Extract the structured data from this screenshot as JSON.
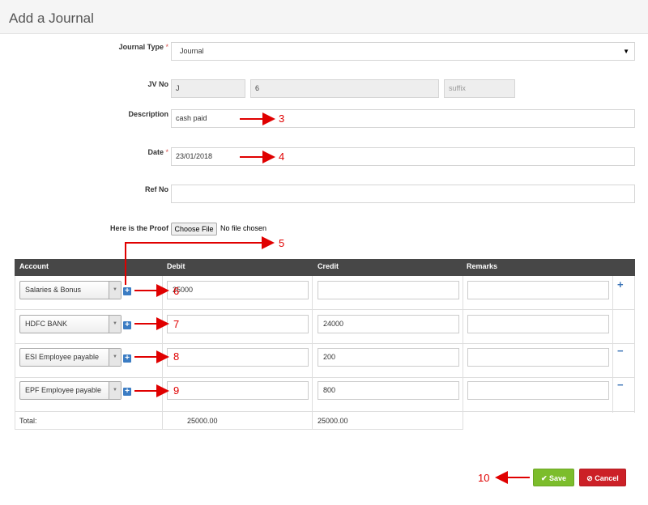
{
  "page": {
    "title": "Add a Journal"
  },
  "form": {
    "journal_type": {
      "label": "Journal Type",
      "required_mark": "*",
      "value": "Journal"
    },
    "jv_no": {
      "label": "JV No",
      "prefix": "J",
      "number": "6",
      "suffix_placeholder": "suffix"
    },
    "description": {
      "label": "Description",
      "value": "cash paid"
    },
    "date": {
      "label": "Date",
      "required_mark": "*",
      "value": "23/01/2018"
    },
    "ref_no": {
      "label": "Ref No",
      "value": ""
    },
    "proof": {
      "label": "Here is the Proof",
      "button_label": "Choose File",
      "status": "No file chosen"
    }
  },
  "grid": {
    "columns": [
      "Account",
      "Debit",
      "Credit",
      "Remarks"
    ],
    "rows": [
      {
        "account": "Salaries & Bonus",
        "debit": "25000",
        "credit": "",
        "remarks": "",
        "action": "+"
      },
      {
        "account": "HDFC BANK",
        "debit": "",
        "credit": "24000",
        "remarks": "",
        "action": ""
      },
      {
        "account": "ESI Employee payable",
        "debit": "",
        "credit": "200",
        "remarks": "",
        "action": "−"
      },
      {
        "account": "EPF Employee payable",
        "debit": "",
        "credit": "800",
        "remarks": "",
        "action": "−"
      }
    ],
    "total": {
      "label": "Total:",
      "debit": "25000.00",
      "credit": "25000.00"
    }
  },
  "annotations": {
    "a3": "3",
    "a4": "4",
    "a5": "5",
    "a6": "6",
    "a7": "7",
    "a8": "8",
    "a9": "9",
    "a10": "10"
  },
  "buttons": {
    "save": "Save",
    "cancel": "Cancel"
  },
  "colors": {
    "annotation": "#e00000",
    "header_bar": "#474747",
    "save": "#7cbd2c",
    "cancel": "#cc2027"
  },
  "icons": {
    "add_account": "plus-square-icon",
    "save": "check-icon",
    "cancel": "ban-icon"
  }
}
